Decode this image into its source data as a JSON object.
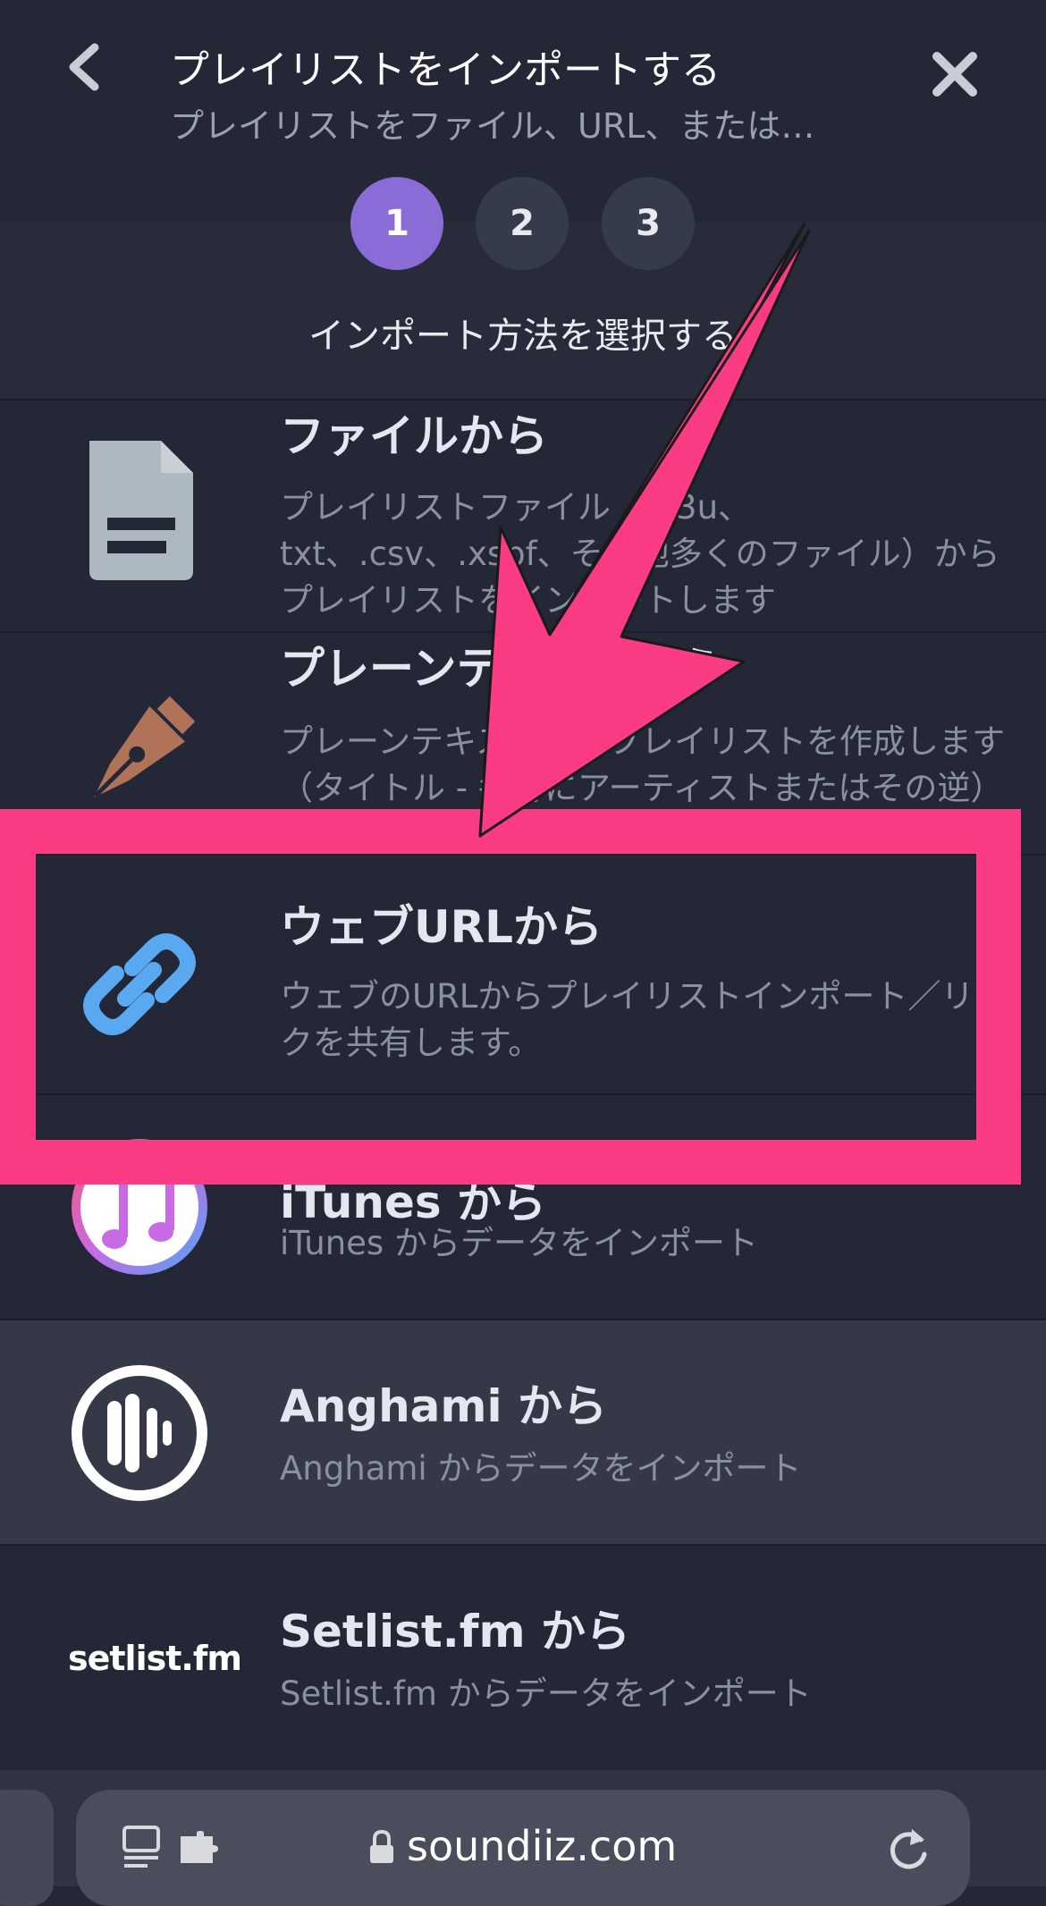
{
  "header": {
    "title": "プレイリストをインポートする",
    "subtitle": "プレイリストをファイル、URL、または…"
  },
  "steps": [
    {
      "label": "1",
      "active": true
    },
    {
      "label": "2",
      "active": false
    },
    {
      "label": "3",
      "active": false
    }
  ],
  "instruction": "インポート方法を選択する",
  "options": [
    {
      "title": "ファイルから",
      "description": "プレイリストファイル（m3u、txt、.csv、.xspf、その他多くのファイル）からプレイリストをインポートします",
      "icon": "file-icon"
    },
    {
      "title": "プレーンテキストから",
      "description": "プレーンテキストからプレイリストを作成します（タイトル - 各行にアーティストまたはその逆）",
      "icon": "fountain-pen-icon"
    },
    {
      "title": "ウェブURLから",
      "description": "ウェブのURLからプレイリストインポート／リンクを共有します。",
      "icon": "link-icon"
    },
    {
      "title": "iTunes から",
      "description": "iTunes からデータをインポート",
      "icon": "itunes-icon"
    },
    {
      "title": "Anghami から",
      "description": "Anghami からデータをインポート",
      "icon": "anghami-icon"
    },
    {
      "title": "Setlist.fm から",
      "description": "Setlist.fm からデータをインポート",
      "icon": "setlistfm-logo"
    }
  ],
  "logos": {
    "setlist": "setlist.fm"
  },
  "browser": {
    "url": "soundiiz.com"
  },
  "colors": {
    "accent": "#8b6bd6",
    "highlight": "#fb3c84",
    "background": "#232736",
    "link": "#5aa9f0"
  }
}
